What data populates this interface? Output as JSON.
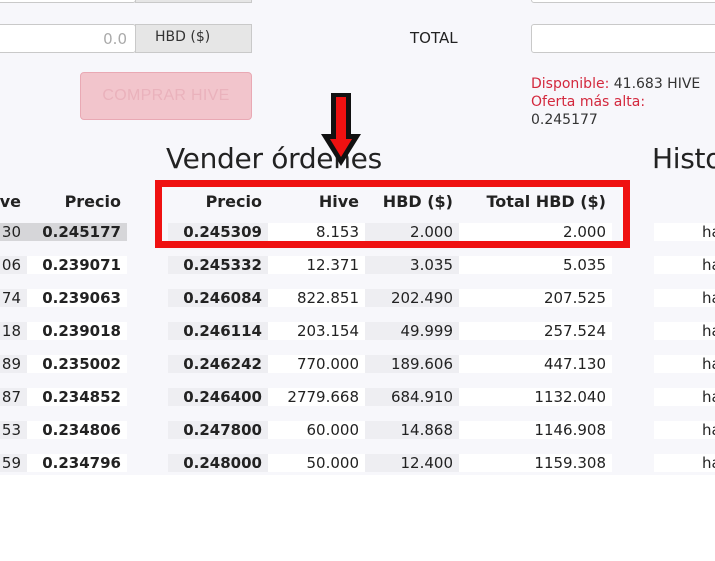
{
  "buy_form": {
    "amount_value": "0.0",
    "currency_addon": "HBD ($)",
    "total_label": "TOTAL",
    "total_value": "",
    "buy_button": "COMPRAR HIVE"
  },
  "balance": {
    "available_label": "Disponible:",
    "available_value": "41.683 HIVE",
    "best_offer_label": "Oferta más alta:",
    "best_offer_value": "0.245177"
  },
  "sell_orders": {
    "title": "Vender órdenes",
    "columns": [
      "Precio",
      "Hive",
      "HBD ($)",
      "Total HBD ($)"
    ],
    "rows": [
      [
        "0.245309",
        "8.153",
        "2.000",
        "2.000"
      ],
      [
        "0.245332",
        "12.371",
        "3.035",
        "5.035"
      ],
      [
        "0.246084",
        "822.851",
        "202.490",
        "207.525"
      ],
      [
        "0.246114",
        "203.154",
        "49.999",
        "257.524"
      ],
      [
        "0.246242",
        "770.000",
        "189.606",
        "447.130"
      ],
      [
        "0.246400",
        "2779.668",
        "684.910",
        "1132.040"
      ],
      [
        "0.247800",
        "60.000",
        "14.868",
        "1146.908"
      ],
      [
        "0.248000",
        "50.000",
        "12.400",
        "1159.308"
      ]
    ]
  },
  "buy_orders": {
    "columns": [
      "ve",
      "Precio"
    ],
    "rows": [
      [
        "30",
        "0.245177"
      ],
      [
        "06",
        "0.239071"
      ],
      [
        "74",
        "0.239063"
      ],
      [
        "18",
        "0.239018"
      ],
      [
        "89",
        "0.235002"
      ],
      [
        "87",
        "0.234852"
      ],
      [
        "53",
        "0.234806"
      ],
      [
        "59",
        "0.234796"
      ]
    ]
  },
  "history": {
    "title": "Histo",
    "rows": [
      "ha",
      "ha",
      "ha",
      "ha",
      "ha",
      "ha",
      "ha",
      "ha"
    ]
  },
  "colors": {
    "annotation": "#ef1111",
    "accent_red": "#d3283d"
  }
}
